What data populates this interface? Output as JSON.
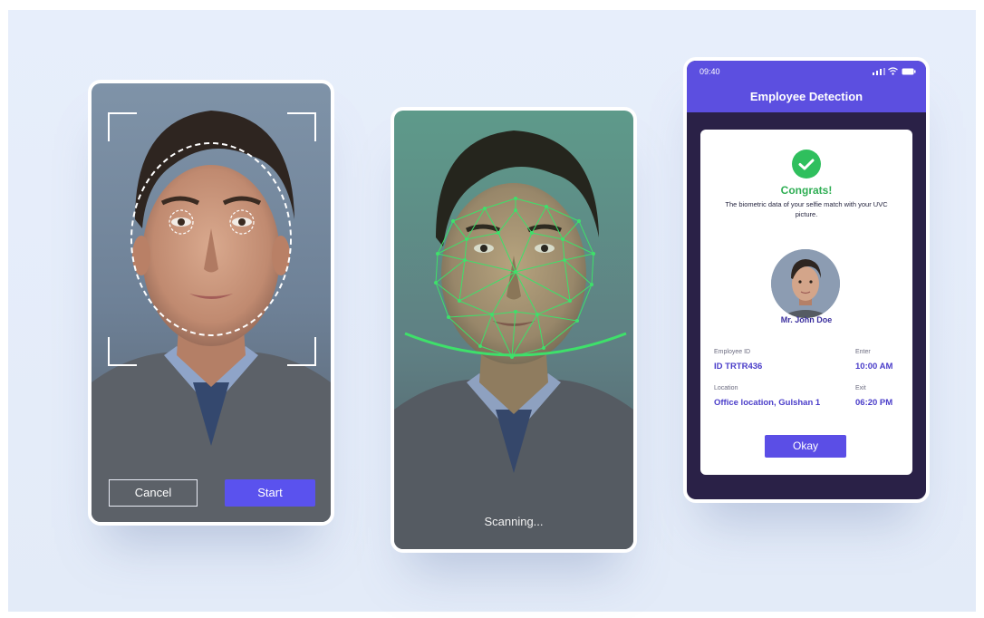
{
  "capture_screen": {
    "cancel_label": "Cancel",
    "start_label": "Start"
  },
  "scan_screen": {
    "status_text": "Scanning..."
  },
  "result_screen": {
    "status_time": "09:40",
    "title": "Employee Detection",
    "success_title": "Congrats!",
    "success_message": "The biometric data of your selfie match with your UVC picture.",
    "employee_name": "Mr. John Doe",
    "employee_id_label": "Employee ID",
    "employee_id_value": "ID TRTR436",
    "enter_label": "Enter",
    "enter_value": "10:00 AM",
    "location_label": "Location",
    "location_value": "Office location, Gulshan 1",
    "exit_label": "Exit",
    "exit_value": "06:20 PM",
    "okay_label": "Okay"
  },
  "colors": {
    "accent": "#5a52ee",
    "header": "#5c4fe0",
    "success": "#2fbf5d",
    "mesh": "#3ee06a",
    "background": "#e5ecf9"
  }
}
